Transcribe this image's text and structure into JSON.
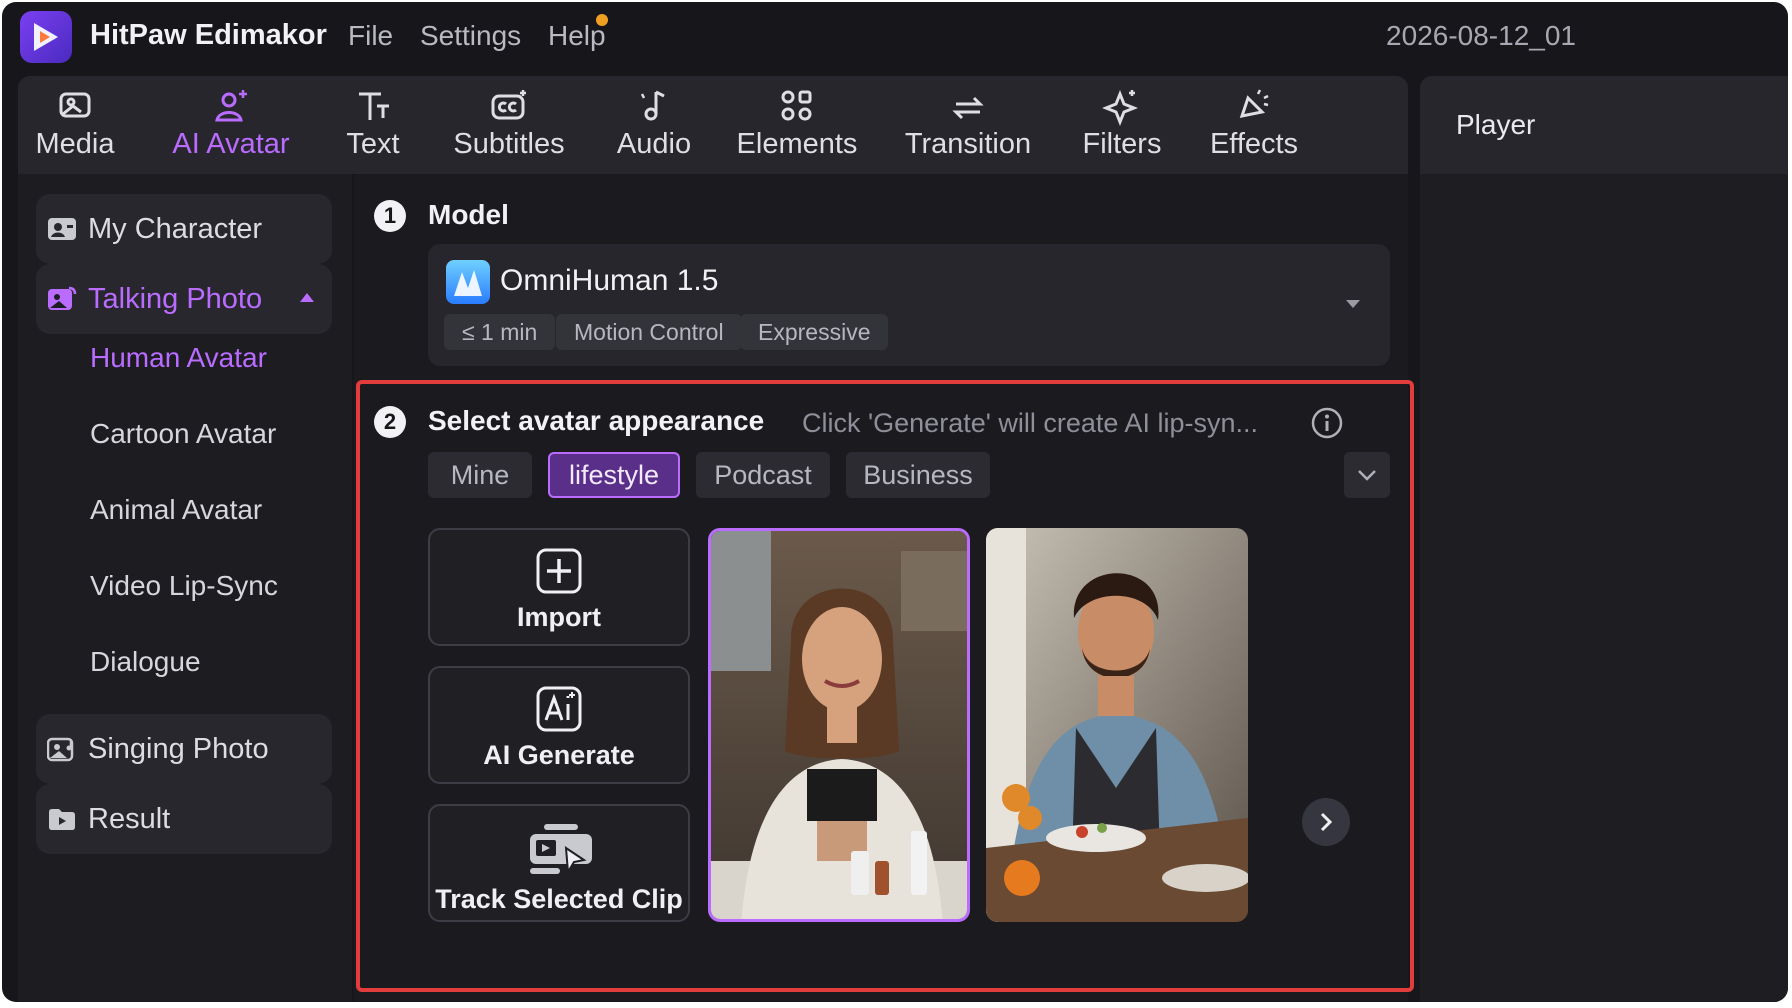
{
  "app": {
    "name": "HitPaw Edimakor",
    "document_title": "2026-08-12_01"
  },
  "menu": [
    "File",
    "Settings",
    "Help"
  ],
  "tabs": [
    {
      "label": "Media",
      "icon": "media-icon"
    },
    {
      "label": "AI Avatar",
      "icon": "ai-avatar-icon",
      "active": true
    },
    {
      "label": "Text",
      "icon": "text-icon"
    },
    {
      "label": "Subtitles",
      "icon": "subtitles-icon"
    },
    {
      "label": "Audio",
      "icon": "audio-icon"
    },
    {
      "label": "Elements",
      "icon": "elements-icon"
    },
    {
      "label": "Transition",
      "icon": "transition-icon"
    },
    {
      "label": "Filters",
      "icon": "filters-icon"
    },
    {
      "label": "Effects",
      "icon": "effects-icon"
    }
  ],
  "player": {
    "title": "Player"
  },
  "sidebar": {
    "my_character": "My Character",
    "talking_photo": "Talking Photo",
    "sub_items": [
      "Human Avatar",
      "Cartoon Avatar",
      "Animal Avatar",
      "Video Lip-Sync",
      "Dialogue"
    ],
    "active_sub_item": "Human Avatar",
    "singing_photo": "Singing Photo",
    "result": "Result"
  },
  "model": {
    "step": "1",
    "title": "Model",
    "name": "OmniHuman 1.5",
    "tags": [
      "≤ 1 min",
      "Motion Control",
      "Expressive"
    ]
  },
  "appearance": {
    "step": "2",
    "title": "Select avatar appearance",
    "hint": "Click 'Generate' will create AI lip-syn...",
    "categories": [
      "Mine",
      "lifestyle",
      "Podcast",
      "Business"
    ],
    "active_category": "lifestyle",
    "actions": {
      "import": "Import",
      "ai_generate": "AI Generate",
      "track_selected_clip": "Track Selected Clip"
    }
  },
  "colors": {
    "accent": "#b96cff",
    "highlight_border": "#e23c3c",
    "background": "#17171b"
  }
}
